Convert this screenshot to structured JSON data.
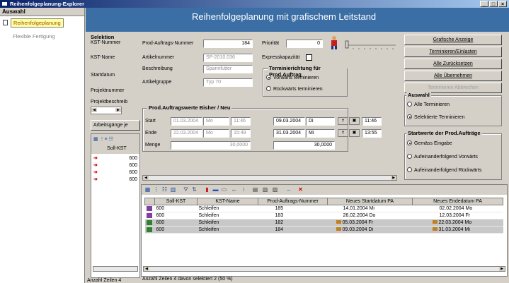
{
  "window": {
    "title": "Reihenfolgeplanung-Explorer",
    "buttons": [
      "_",
      "□",
      "×"
    ]
  },
  "left": {
    "header": "Auswahl",
    "items": [
      {
        "label": "Reihenfolgeplanung",
        "selected": true
      },
      {
        "label": "Flexible Fertigung",
        "selected": false
      }
    ]
  },
  "caption": "Reihenfolgeplanung mit grafischem Leitstand",
  "side": {
    "selektion_title": "Selektion",
    "labels": [
      "KST-Nummer",
      "KST-Name",
      "Startdatum",
      "Projektnummer",
      "Projektbeschreib"
    ],
    "tab": "Arbeitsgänge je",
    "col_header": "Soll-KST",
    "values": [
      "600",
      "600",
      "600",
      "600"
    ],
    "status": "Anzahl Zeilen 4"
  },
  "form": {
    "prod_nr_label": "Prod-Auftrags-Nummer",
    "prod_nr": "184",
    "prio_label": "Priorität",
    "prio": "0",
    "artikelnr_label": "Artikelnummer",
    "artikelnr": "SP-2010.036",
    "beschreibung_label": "Beschreibung",
    "beschreibung": "Spannfutter",
    "artikelgruppe_label": "Artikelgruppe",
    "artikelgruppe": "Typ 70",
    "express_label": "Expresskapazität",
    "termin_group": "Terminierichtung für Prod.Auftrag",
    "termin_opts": [
      "Vorwärts terminieren",
      "Rückwärts terminieren"
    ],
    "werte_group": "Prod.Auftragswerte Bisher / Neu",
    "start_label": "Start",
    "ende_label": "Ende",
    "menge_label": "Menge",
    "start_old_date": "01.03.2004",
    "start_old_day": "Mo",
    "start_old_time": "11:46",
    "ende_old_date": "22.03.2004",
    "ende_old_day": "Mo",
    "ende_old_time": "15:49",
    "menge_old": "30,0000",
    "start_new_date": "09.03.2004",
    "start_new_day": "Di",
    "start_new_time": "11:46",
    "ende_new_date": "31.03.2004",
    "ende_new_day": "Mi",
    "ende_new_time": "13:55",
    "menge_new": "30,0000"
  },
  "buttons": {
    "grafische_anzeige": "Grafische Anzeige",
    "terminieren": "Terminieren/Einlasten",
    "alle_zurueck": "Alle Zurücksetzen",
    "alle_uebernehmen": "Alle Übernehmen",
    "terminieren_abbrechen": "Terminieren Abbrechen"
  },
  "auswahl": {
    "title": "Auswahl",
    "opts": [
      "Alle Terminieren",
      "Selektierte Terminieren"
    ]
  },
  "startwerte": {
    "title": "Startwerte der Prod.Aufträge",
    "opts": [
      "Gemäss Eingabe",
      "Aufeinanderfolgend Vorwärts",
      "Aufeinanderfolgend Rückwärts"
    ]
  },
  "grid": {
    "columns": [
      "Soll-KST",
      "KST-Name",
      "Prod-Auftrags-Nummer",
      "Neues Startdatum PA",
      "Neues Endedatum PA"
    ],
    "rows": [
      {
        "kst": "600",
        "name": "Schleifen",
        "nr": "185",
        "start": "14.01.2004",
        "sday": "Mi",
        "ende": "02.02.2004",
        "eday": "Mo",
        "flag": false,
        "sel": false
      },
      {
        "kst": "600",
        "name": "Schleifen",
        "nr": "183",
        "start": "26.02.2004",
        "sday": "Do",
        "ende": "12.03.2004",
        "eday": "Fr",
        "flag": false,
        "sel": false
      },
      {
        "kst": "600",
        "name": "Schleifen",
        "nr": "182",
        "start": "05.03.2004",
        "sday": "Fr",
        "ende": "22.03.2004",
        "eday": "Mo",
        "flag": true,
        "sel": true
      },
      {
        "kst": "600",
        "name": "Schleifen",
        "nr": "184",
        "start": "09.03.2004",
        "sday": "Di",
        "ende": "31.03.2004",
        "eday": "Mi",
        "flag": true,
        "sel": true
      }
    ],
    "status": "Anzahl Zeilen 4   davon selektiert 2   (50 %)"
  }
}
